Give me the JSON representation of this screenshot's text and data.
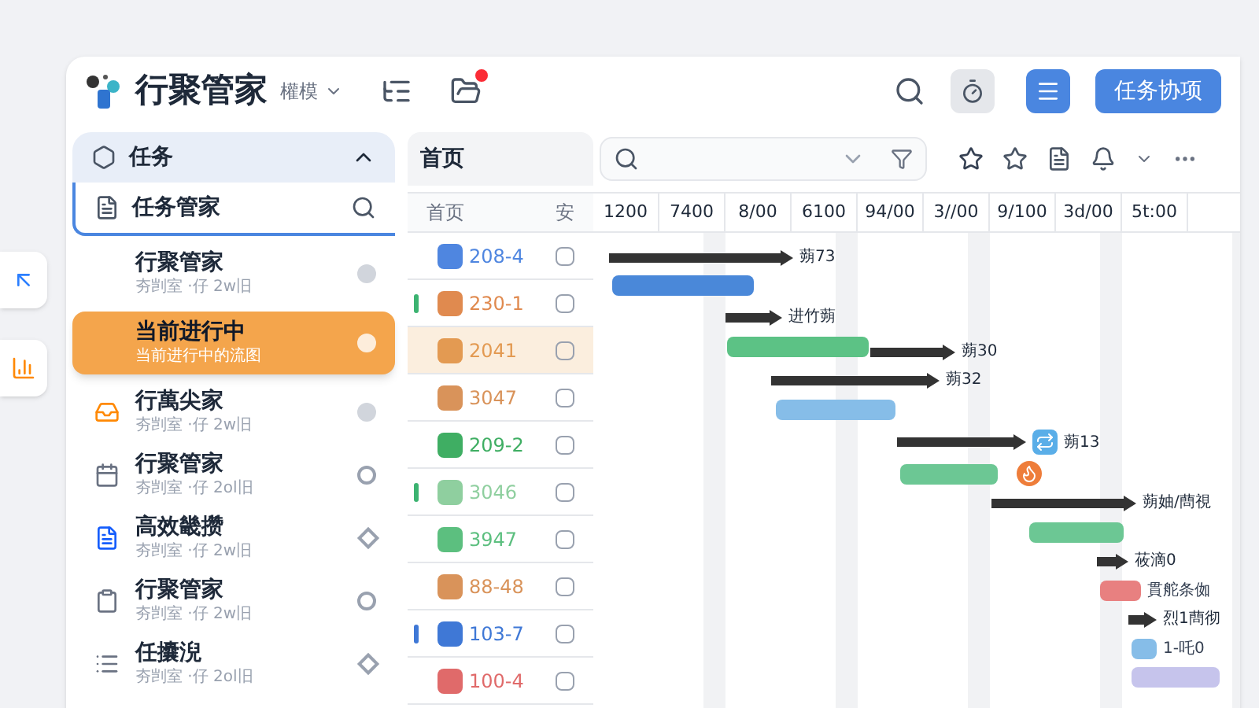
{
  "app": {
    "title": "行聚管家",
    "subtitle": "權模"
  },
  "header_buttons": [
    {
      "label": "任务协项"
    }
  ],
  "sidebar": {
    "section": {
      "label": "任务",
      "expanded": true
    },
    "search_item": {
      "label": "任务管家"
    },
    "items": [
      {
        "title": "行聚管家",
        "subtitle": "夯剀室 ·仔 2w旧",
        "selected": false
      },
      {
        "title": "当前进行中",
        "subtitle": "当前进行中的流图",
        "selected": true
      },
      {
        "title": "行萬尖家",
        "subtitle": "夯剀室 ·仔 2w旧",
        "selected": false
      },
      {
        "title": "行聚管家",
        "subtitle": "夯剀室 ·仔 2ol旧",
        "selected": false
      },
      {
        "title": "高效畿攒",
        "subtitle": "夯剀室 ·仔 2w旧",
        "selected": false
      },
      {
        "title": "行聚管家",
        "subtitle": "夯剀室 ·仔 2w旧",
        "selected": false
      },
      {
        "title": "任攮淣",
        "subtitle": "夯剀室 ·仔 2ol旧",
        "selected": false
      }
    ]
  },
  "list": {
    "title": "首页",
    "column_1": "首页",
    "column_2": "安",
    "rows": [
      {
        "code": "208-4",
        "color": "#4f86e0",
        "selected": false,
        "checked": false
      },
      {
        "code": "230-1",
        "color": "#e08a4f",
        "accent": {
          "color": "#3cb371"
        },
        "selected": false,
        "checked": false
      },
      {
        "code": "2041",
        "color": "#e39a52",
        "selected": true,
        "checked": false
      },
      {
        "code": "3047",
        "color": "#d9935a",
        "selected": false,
        "checked": false
      },
      {
        "code": "209-2",
        "color": "#3fae63",
        "selected": false,
        "checked": false
      },
      {
        "code": "3046",
        "color": "#8fcf9f",
        "accent": {
          "color": "#3cb371"
        },
        "selected": false,
        "checked": false
      },
      {
        "code": "3947",
        "color": "#5cbf7f",
        "selected": false,
        "checked": false
      },
      {
        "code": "88-48",
        "color": "#d9935a",
        "selected": false,
        "checked": false
      },
      {
        "code": "103-7",
        "color": "#3f78d6",
        "accent": {
          "color": "#3f78d6"
        },
        "selected": false,
        "checked": false
      },
      {
        "code": "100-4",
        "color": "#e06a6a",
        "selected": false,
        "checked": false
      }
    ]
  },
  "gantt": {
    "hours": [
      "1200",
      "7400",
      "8/00",
      "6100",
      "94/00",
      "3//00",
      "9/100",
      "3d/00",
      "5t:00"
    ],
    "bars": [
      {
        "kind": "summary",
        "color": "#333333",
        "label": "蒴73"
      },
      {
        "kind": "task",
        "color": "#4a88d9"
      },
      {
        "kind": "summary",
        "color": "#333333",
        "label": "进竹蒴"
      },
      {
        "kind": "task",
        "color": "#5cc285"
      },
      {
        "kind": "summary",
        "color": "#333333",
        "label": "蒴30"
      },
      {
        "kind": "summary",
        "color": "#333333",
        "label": "蒴32"
      },
      {
        "kind": "task",
        "color": "#86bde8"
      },
      {
        "kind": "summary",
        "color": "#333333",
        "label": "蒴13"
      },
      {
        "kind": "task",
        "color": "#6cc794"
      },
      {
        "kind": "summary",
        "color": "#333333",
        "label": "蒴妯/蔄視"
      },
      {
        "kind": "task",
        "color": "#6cc794"
      },
      {
        "kind": "summary",
        "color": "#333333",
        "label": "莜滴0"
      },
      {
        "kind": "task",
        "color": "#e88080",
        "label": "貫舵条侞"
      },
      {
        "kind": "summary",
        "color": "#333333",
        "label": "烈1蔄彻"
      },
      {
        "kind": "task",
        "color": "#86bde8",
        "label": "1-吒0"
      },
      {
        "kind": "task",
        "color": "#c6c4ec"
      }
    ]
  }
}
